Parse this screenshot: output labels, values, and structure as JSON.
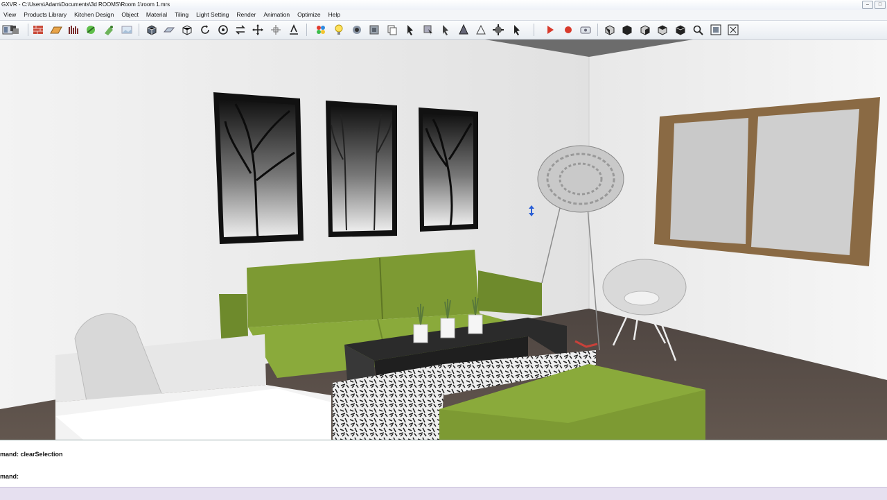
{
  "window": {
    "title": "GXVR - C:\\Users\\Adam\\Documents\\3d ROOMS\\Room 1\\room 1.mrs",
    "controls": [
      "–",
      "□"
    ]
  },
  "menu": [
    "View",
    "Products Library",
    "Kitchen Design",
    "Object",
    "Material",
    "Tiling",
    "Light Setting",
    "Render",
    "Animation",
    "Optimize",
    "Help"
  ],
  "toolbar": {
    "icons": [
      "layout-icon",
      "shapes-icon",
      "wall-icon",
      "floor-icon",
      "material-icon",
      "texture-icon",
      "paint-icon",
      "landscape-icon",
      "box-icon",
      "plane-icon",
      "cube-icon",
      "rotate-icon",
      "orbit-icon",
      "swap-icon",
      "move-icon",
      "scale-icon",
      "align-icon",
      "palette-icon",
      "light-icon",
      "camera-icon",
      "render-icon",
      "copy-icon",
      "select-icon",
      "pick-icon",
      "pointer-icon",
      "cone-icon",
      "settings-icon",
      "arrow-icon",
      "play-icon",
      "record-icon",
      "video-icon",
      "view-front-icon",
      "view-back-icon",
      "view-left-icon",
      "view-right-icon",
      "view-top-icon",
      "zoom-icon",
      "zoom-extents-icon",
      "fit-view-icon"
    ]
  },
  "command": {
    "history_line": "mand: clearSelection",
    "prompt_line": "mand:"
  },
  "colors": {
    "sofa_green": "#7d9a33",
    "floor": "#5a4f4a",
    "wall": "#f2f2f2",
    "window_frame": "#8a6a44",
    "status_bar": "#e6e0f0"
  }
}
